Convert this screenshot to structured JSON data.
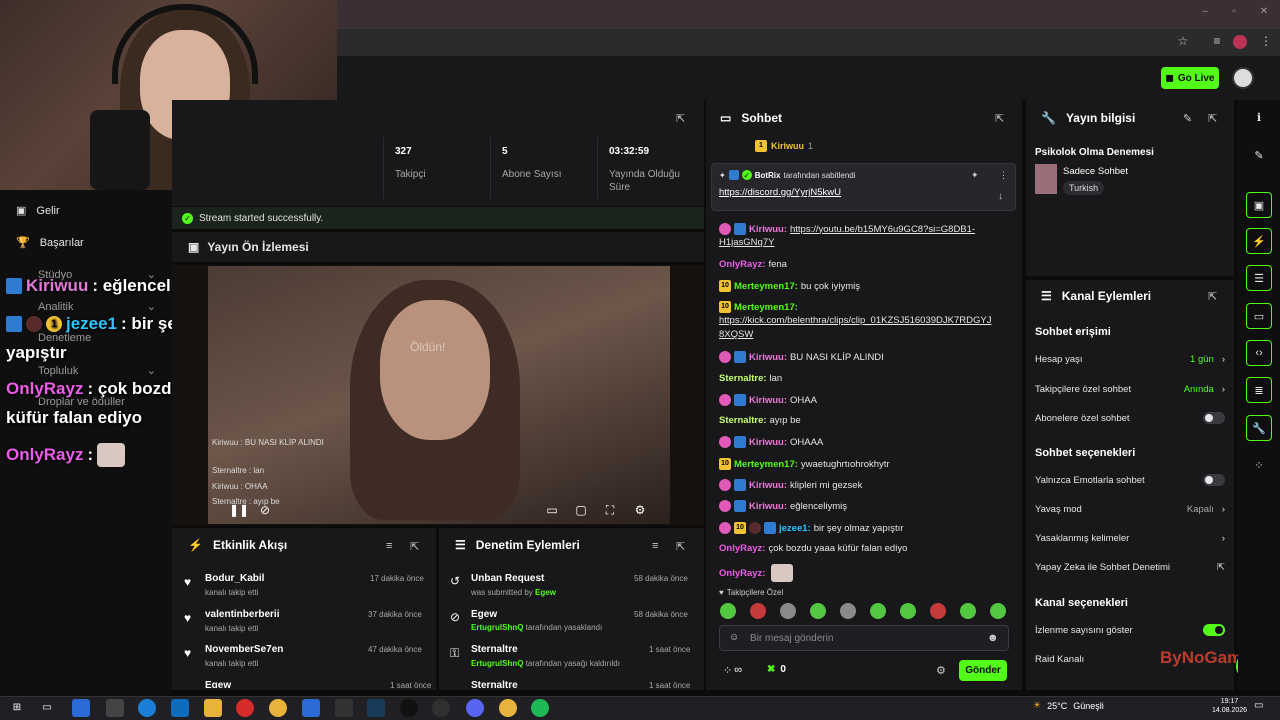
{
  "site": {
    "go_live": "Go Live"
  },
  "left_nav": [
    {
      "label": "Gelir"
    },
    {
      "label": "Başarılar"
    },
    {
      "label": "Stüdyo"
    },
    {
      "label": "Analitik"
    },
    {
      "label": "Denetleme"
    },
    {
      "label": "Topluluk"
    },
    {
      "label": "Droplar ve ödüller"
    }
  ],
  "overlay_chat": [
    {
      "user": "Kiriwuu",
      "text": ": eğlenceliymiş"
    },
    {
      "user": "jezee1",
      "text": ": bir şey olmaz"
    },
    {
      "cont": "yapıştır"
    },
    {
      "user": "OnlyRayz",
      "text": ": çok bozdu yaaa"
    },
    {
      "cont": "küfür falan ediyo"
    },
    {
      "user": "OnlyRayz",
      "text": ":"
    }
  ],
  "stats": [
    {
      "value": "327",
      "label": "Takipçi"
    },
    {
      "value": "5",
      "label": "Abone Sayısı"
    },
    {
      "value": "03:32:59",
      "label": "Yayında Olduğu Süre"
    }
  ],
  "success_msg": "Stream started successfully.",
  "preview": {
    "title": "Yayın Ön İzlemesi",
    "overlay_text": "Öldün!",
    "chat": [
      "Kiriwuu : BU NASI KLİP ALINDI",
      "Sternaltre : lan",
      "Kiriwuu : OHAA",
      "Sternaltre : ayıp be"
    ]
  },
  "activity": {
    "title": "Etkinlik Akışı",
    "items": [
      {
        "name": "Bodur_Kabil",
        "sub": "kanalı takip etti",
        "time": "17 dakika önce"
      },
      {
        "name": "valentinberberii",
        "sub": "kanalı takip etti",
        "time": "37 dakika önce"
      },
      {
        "name": "NovemberSe7en",
        "sub": "kanalı takip etti",
        "time": "47 dakika önce"
      },
      {
        "name": "Egew",
        "sub": "",
        "time": "1 saat önce"
      }
    ]
  },
  "moderation": {
    "title": "Denetim Eylemleri",
    "items": [
      {
        "name": "Unban Request",
        "sub": "was submitted by",
        "actor": "Egew",
        "time": "58 dakika önce"
      },
      {
        "name": "Egew",
        "sub": "tarafından yasaklandı",
        "actor": "ErtugrulShnQ",
        "time": "58 dakika önce"
      },
      {
        "name": "Sternaltre",
        "sub": "tarafından yasağı kaldırıldı",
        "actor": "ErtugrulShnQ",
        "time": "1 saat önce"
      },
      {
        "name": "Sternaltre",
        "sub": "",
        "actor": "",
        "time": "1 saat önce"
      }
    ]
  },
  "chat": {
    "title": "Sohbet",
    "top_user": "Kiriwuu",
    "top_count": "1",
    "pinned": {
      "user": "BotRix",
      "note": "tarafından sabitlendi",
      "link": "https://discord.gg/YyrjN5kwU"
    },
    "messages": [
      {
        "user": "Kiriwuu",
        "cls": "u-kiri",
        "badges": [
          "pink",
          "blue"
        ],
        "text": "https://youtu.be/b15MY6u9GC8?si=G8DB1-",
        "cont": "H1jasGNq7Y",
        "link": true
      },
      {
        "user": "OnlyRayz",
        "cls": "u-only",
        "badges": [],
        "text": "fena"
      },
      {
        "user": "Merteymen17",
        "cls": "u-mert",
        "badges": [
          "gold"
        ],
        "text": "bu çok iyiymiş"
      },
      {
        "user": "Merteymen17",
        "cls": "u-mert",
        "badges": [
          "gold"
        ],
        "text": "",
        "cont": "https://kick.com/belenthra/clips/clip_01KZSJ516039DJK7RDGYJ",
        "cont2": "8XQSW",
        "link": true
      },
      {
        "user": "Kiriwuu",
        "cls": "u-kiri",
        "badges": [
          "pink",
          "blue"
        ],
        "text": "BU NASI KLİP ALINDI"
      },
      {
        "user": "Sternaltre",
        "cls": "u-ster",
        "badges": [],
        "text": "lan"
      },
      {
        "user": "Kiriwuu",
        "cls": "u-kiri",
        "badges": [
          "pink",
          "blue"
        ],
        "text": "OHAA"
      },
      {
        "user": "Sternaltre",
        "cls": "u-ster",
        "badges": [],
        "text": "ayıp be"
      },
      {
        "user": "Kiriwuu",
        "cls": "u-kiri",
        "badges": [
          "pink",
          "blue"
        ],
        "text": "OHAAA"
      },
      {
        "user": "Merteymen17",
        "cls": "u-mert",
        "badges": [
          "gold"
        ],
        "text": "ywaetughrtıohrokhytr"
      },
      {
        "user": "Kiriwuu",
        "cls": "u-kiri",
        "badges": [
          "pink",
          "blue"
        ],
        "text": "klipleri mi gezsek"
      },
      {
        "user": "Kiriwuu",
        "cls": "u-kiri",
        "badges": [
          "pink",
          "blue"
        ],
        "text": "eğlenceliymiş"
      },
      {
        "user": "jezee1",
        "cls": "u-jez",
        "badges": [
          "pink",
          "gold",
          "red",
          "blue"
        ],
        "text": "bir şey olmaz yapıştır"
      },
      {
        "user": "OnlyRayz",
        "cls": "u-only",
        "badges": [],
        "text": "çok bozdu yaaa küfür falan ediyo"
      },
      {
        "user": "OnlyRayz",
        "cls": "u-only",
        "badges": [],
        "text": ""
      }
    ],
    "followers_only": "Takipçilere Özel",
    "input_placeholder": "Bir mesaj gönderin",
    "infinity": "∞",
    "zero": "0",
    "send": "Gönder"
  },
  "stream_info": {
    "title": "Yayın bilgisi",
    "stream_title": "Psikolok Olma Denemesi",
    "category": "Sadece Sohbet",
    "tag": "Turkish"
  },
  "channel_actions": {
    "title": "Kanal Eylemleri",
    "chat_access": "Sohbet erişimi",
    "account_age": {
      "label": "Hesap yaşı",
      "value": "1 gün"
    },
    "followers_chat": {
      "label": "Takipçilere özel sohbet",
      "value": "Anında"
    },
    "subs_chat": {
      "label": "Abonelere özel sohbet"
    },
    "chat_options": "Sohbet seçenekleri",
    "emote_only": {
      "label": "Yalnızca Emotlarla sohbet"
    },
    "slow_mode": {
      "label": "Yavaş mod",
      "value": "Kapalı"
    },
    "banned_words": {
      "label": "Yasaklanmış kelimeler"
    },
    "ai_mod": {
      "label": "Yapay Zeka ile Sohbet Denetimi"
    },
    "channel_options": "Kanal seçenekleri",
    "show_viewers": {
      "label": "İzlenme sayısını göster"
    },
    "raid": {
      "label": "Raid Kanalı"
    }
  },
  "taskbar": {
    "weather": "25°C",
    "weather_desc": "Güneşli",
    "time": "19:17",
    "date": "14.08.2026"
  },
  "watermark": "ByNoGame",
  "colors": {
    "accent": "#53fc18",
    "panel": "#18181b"
  }
}
